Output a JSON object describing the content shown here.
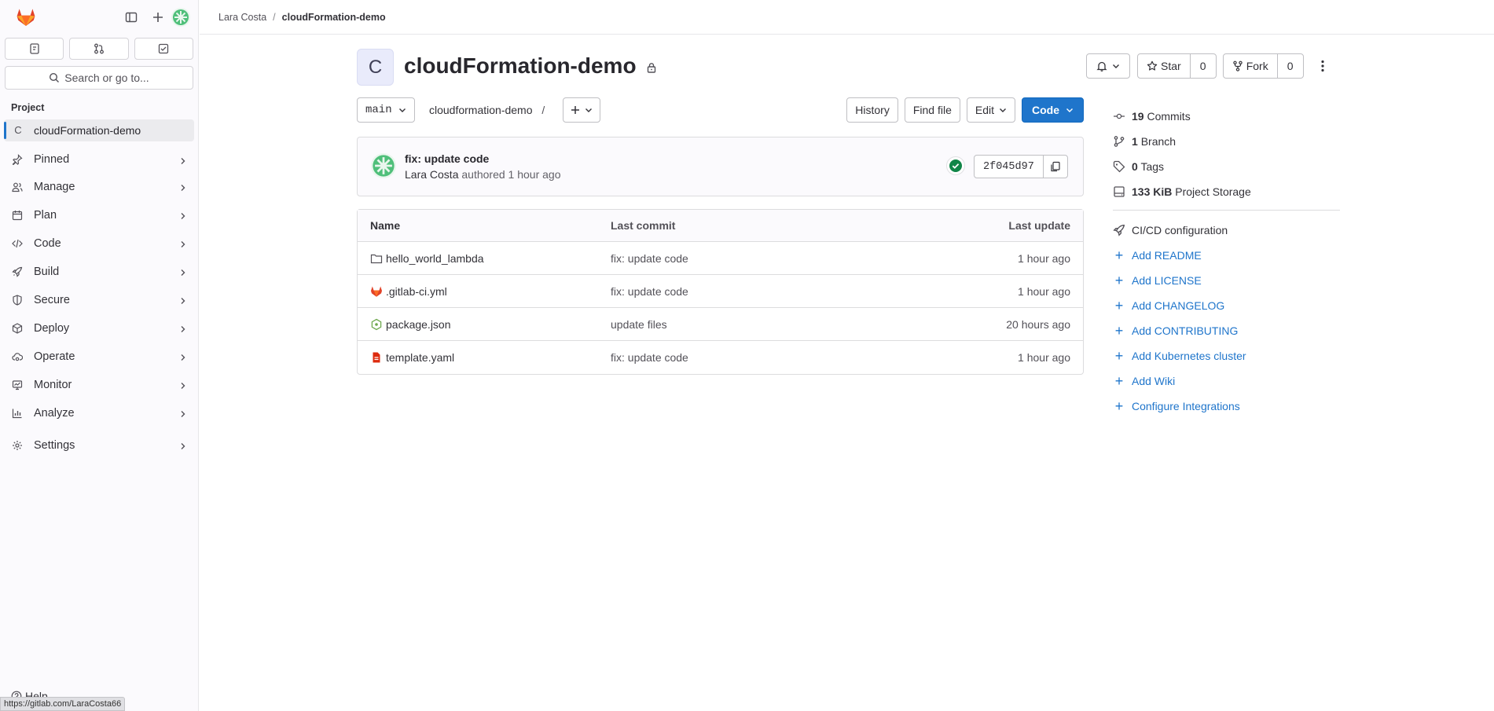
{
  "sidebar": {
    "search_label": "Search or go to...",
    "section_label": "Project",
    "current_project_letter": "C",
    "current_project_name": "cloudFormation-demo",
    "items": [
      {
        "label": "Pinned"
      },
      {
        "label": "Manage"
      },
      {
        "label": "Plan"
      },
      {
        "label": "Code"
      },
      {
        "label": "Build"
      },
      {
        "label": "Secure"
      },
      {
        "label": "Deploy"
      },
      {
        "label": "Operate"
      },
      {
        "label": "Monitor"
      },
      {
        "label": "Analyze"
      },
      {
        "label": "Settings"
      }
    ],
    "help_label": "Help"
  },
  "status_url": "https://gitlab.com/LaraCosta66",
  "breadcrumb": {
    "owner": "Lara Costa",
    "project": "cloudFormation-demo"
  },
  "project": {
    "avatar_letter": "C",
    "title": "cloudFormation-demo",
    "star_label": "Star",
    "star_count": "0",
    "fork_label": "Fork",
    "fork_count": "0"
  },
  "repo": {
    "branch": "main",
    "path": "cloudformation-demo",
    "path_sep": "/",
    "history_label": "History",
    "find_file_label": "Find file",
    "edit_label": "Edit",
    "code_label": "Code"
  },
  "commit": {
    "message": "fix: update code",
    "author": "Lara Costa",
    "authored_text": "authored 1 hour ago",
    "sha": "2f045d97"
  },
  "files": {
    "headers": {
      "name": "Name",
      "last_commit": "Last commit",
      "last_update": "Last update"
    },
    "rows": [
      {
        "name": "hello_world_lambda",
        "commit": "fix: update code",
        "updated": "1 hour ago"
      },
      {
        "name": ".gitlab-ci.yml",
        "commit": "fix: update code",
        "updated": "1 hour ago"
      },
      {
        "name": "package.json",
        "commit": "update files",
        "updated": "20 hours ago"
      },
      {
        "name": "template.yaml",
        "commit": "fix: update code",
        "updated": "1 hour ago"
      }
    ]
  },
  "stats": {
    "commits_count": "19",
    "commits_label": "Commits",
    "branch_count": "1",
    "branch_label": "Branch",
    "tags_count": "0",
    "tags_label": "Tags",
    "storage_size": "133 KiB",
    "storage_label": "Project Storage"
  },
  "quick_links": {
    "cicd": "CI/CD configuration",
    "readme": "Add README",
    "license": "Add LICENSE",
    "changelog": "Add CHANGELOG",
    "contributing": "Add CONTRIBUTING",
    "kubernetes": "Add Kubernetes cluster",
    "wiki": "Add Wiki",
    "integrations": "Configure Integrations"
  },
  "colors": {
    "accent": "#1f75cb",
    "success": "#108548",
    "brand": "#e24329"
  }
}
